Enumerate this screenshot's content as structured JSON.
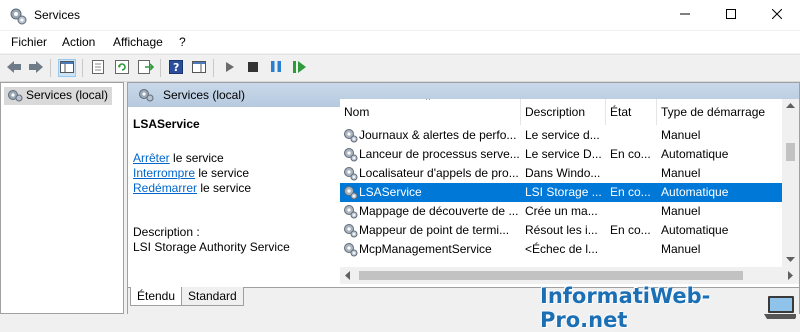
{
  "window": {
    "title": "Services",
    "icons": {
      "app": "gears-icon",
      "minimize": "minimize-icon",
      "maximize": "maximize-icon",
      "close": "close-icon"
    }
  },
  "menu": {
    "items": [
      "Fichier",
      "Action",
      "Affichage",
      "?"
    ]
  },
  "toolbar": {
    "icons": [
      "back-arrow-icon",
      "forward-arrow-icon",
      "show-console-tree-icon",
      "properties-icon",
      "refresh-icon",
      "export-list-icon",
      "help-icon",
      "show-hide-action-pane-icon",
      "start-service-icon",
      "stop-service-icon",
      "pause-service-icon",
      "restart-service-icon"
    ]
  },
  "tree": {
    "root_label": "Services (local)"
  },
  "pane": {
    "header": "Services (local)"
  },
  "details": {
    "service_name": "LSAService",
    "actions": [
      {
        "link": "Arrêter",
        "rest": " le service"
      },
      {
        "link": "Interrompre",
        "rest": " le service"
      },
      {
        "link": "Redémarrer",
        "rest": " le service"
      }
    ],
    "description_label": "Description :",
    "description": "LSI Storage Authority Service"
  },
  "grid": {
    "columns": [
      "Nom",
      "Description",
      "État",
      "Type de démarrage"
    ],
    "rows": [
      {
        "name": "Journaux & alertes de perfo...",
        "description": "Le service d...",
        "state": "",
        "startup": "Manuel",
        "selected": false
      },
      {
        "name": "Lanceur de processus serve...",
        "description": "Le service D...",
        "state": "En co...",
        "startup": "Automatique",
        "selected": false
      },
      {
        "name": "Localisateur d'appels de pro...",
        "description": "Dans Windo...",
        "state": "",
        "startup": "Manuel",
        "selected": false
      },
      {
        "name": "LSAService",
        "description": "LSI Storage ...",
        "state": "En co...",
        "startup": "Automatique",
        "selected": true
      },
      {
        "name": "Mappage de découverte de ...",
        "description": "Crée un ma...",
        "state": "",
        "startup": "Manuel",
        "selected": false
      },
      {
        "name": "Mappeur de point de termi...",
        "description": "Résout les i...",
        "state": "En co...",
        "startup": "Automatique",
        "selected": false
      },
      {
        "name": "McpManagementService",
        "description": "<Échec de l...",
        "state": "",
        "startup": "Manuel",
        "selected": false
      }
    ]
  },
  "tabs": {
    "items": [
      "Étendu",
      "Standard"
    ],
    "active": "Étendu"
  },
  "watermark": {
    "text": "InformatiWeb-Pro.net"
  },
  "colors": {
    "selection": "#0078d7",
    "link": "#0066cc",
    "pane_header": "#c9d9ea"
  }
}
